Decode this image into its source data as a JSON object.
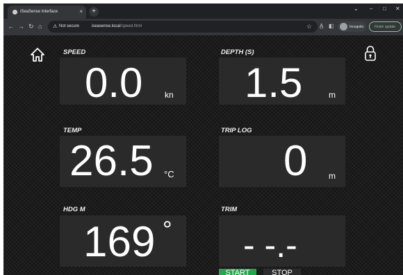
{
  "browser": {
    "tab_title": "iSeaSense Interface",
    "tab_close": "×",
    "new_tab": "+",
    "window_controls": {
      "minimize": "–",
      "maximize": "□",
      "close": "✕",
      "chevron": "⌄"
    },
    "nav": {
      "back": "←",
      "forward": "→",
      "reload": "↻",
      "home": "⌂"
    },
    "address": {
      "security_icon": "warning-triangle-icon",
      "security_label": "Not secure",
      "host": "iseasense.local",
      "path": "/speed.html"
    },
    "profile_label": "Incognito",
    "finish_update_label": "Finish update"
  },
  "dashboard": {
    "speed": {
      "label": "SPEED",
      "value": "0.0",
      "unit": "kn"
    },
    "depth": {
      "label": "DEPTH (S)",
      "value": "1.5",
      "unit": "m"
    },
    "temp": {
      "label": "TEMP",
      "value": "26.5",
      "unit": "°C"
    },
    "trip": {
      "label": "TRIP LOG",
      "value": "0",
      "unit": "m"
    },
    "heading": {
      "label": "HDG M",
      "value": "169",
      "unit": "°"
    },
    "trim": {
      "label": "TRIM",
      "value": "- -.-"
    },
    "start_label": "START",
    "stop_label": "STOP"
  },
  "colors": {
    "start_green": "#22a84a",
    "panel": "#2a2a2a",
    "background": "#141414"
  }
}
